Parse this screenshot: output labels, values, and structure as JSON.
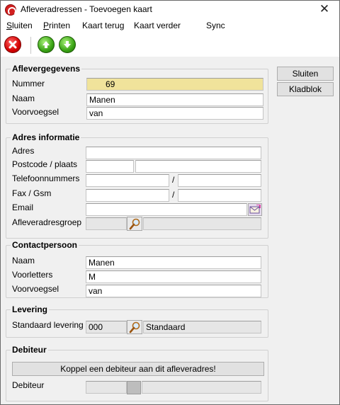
{
  "window": {
    "title": "Afleveradressen - Toevoegen kaart",
    "close_glyph": "✕"
  },
  "menu": [
    {
      "label": "Sluiten",
      "mnemonic": "S",
      "rest": "luiten"
    },
    {
      "label": "Printen",
      "mnemonic": "P",
      "rest": "rinten"
    },
    {
      "label": "Kaart terug"
    },
    {
      "label": "Kaart verder"
    },
    {
      "label": "Sync"
    }
  ],
  "toolbar": {
    "buttons": [
      "close-red-icon",
      "arrow-up-green-icon",
      "arrow-down-green-icon"
    ]
  },
  "side_buttons": {
    "sluiten": "Sluiten",
    "kladblok": "Kladblok"
  },
  "aflevergegevens": {
    "title": "Aflevergegevens",
    "nummer_label": "Nummer",
    "nummer_value": "69",
    "naam_label": "Naam",
    "naam_value": "Manen",
    "voorvoegsel_label": "Voorvoegsel",
    "voorvoegsel_value": "van"
  },
  "adres_informatie": {
    "title": "Adres informatie",
    "adres_label": "Adres",
    "adres_value": "",
    "postcode_label": "Postcode / plaats",
    "postcode_value": "",
    "plaats_value": "",
    "telefoon_label": "Telefoonnummers",
    "telefoon1_value": "",
    "telefoon2_value": "",
    "fax_label": "Fax / Gsm",
    "fax_value": "",
    "gsm_value": "",
    "email_label": "Email",
    "email_value": "",
    "groep_label": "Afleveradresgroep",
    "groep_code": "",
    "groep_name": "",
    "separator": "/"
  },
  "contactpersoon": {
    "title": "Contactpersoon",
    "naam_label": "Naam",
    "naam_value": "Manen",
    "voorletters_label": "Voorletters",
    "voorletters_value": "M",
    "voorvoegsel_label": "Voorvoegsel",
    "voorvoegsel_value": "van"
  },
  "levering": {
    "title": "Levering",
    "standaard_label": "Standaard levering",
    "code_value": "000",
    "name_value": "Standaard"
  },
  "debiteur": {
    "title": "Debiteur",
    "koppel_button": "Koppel een debiteur aan dit afleveradres!",
    "debiteur_label": "Debiteur",
    "debiteur_value": ""
  },
  "colors": {
    "highlight_field": "#f0e39b",
    "window_bg": "#f0f0f0"
  }
}
